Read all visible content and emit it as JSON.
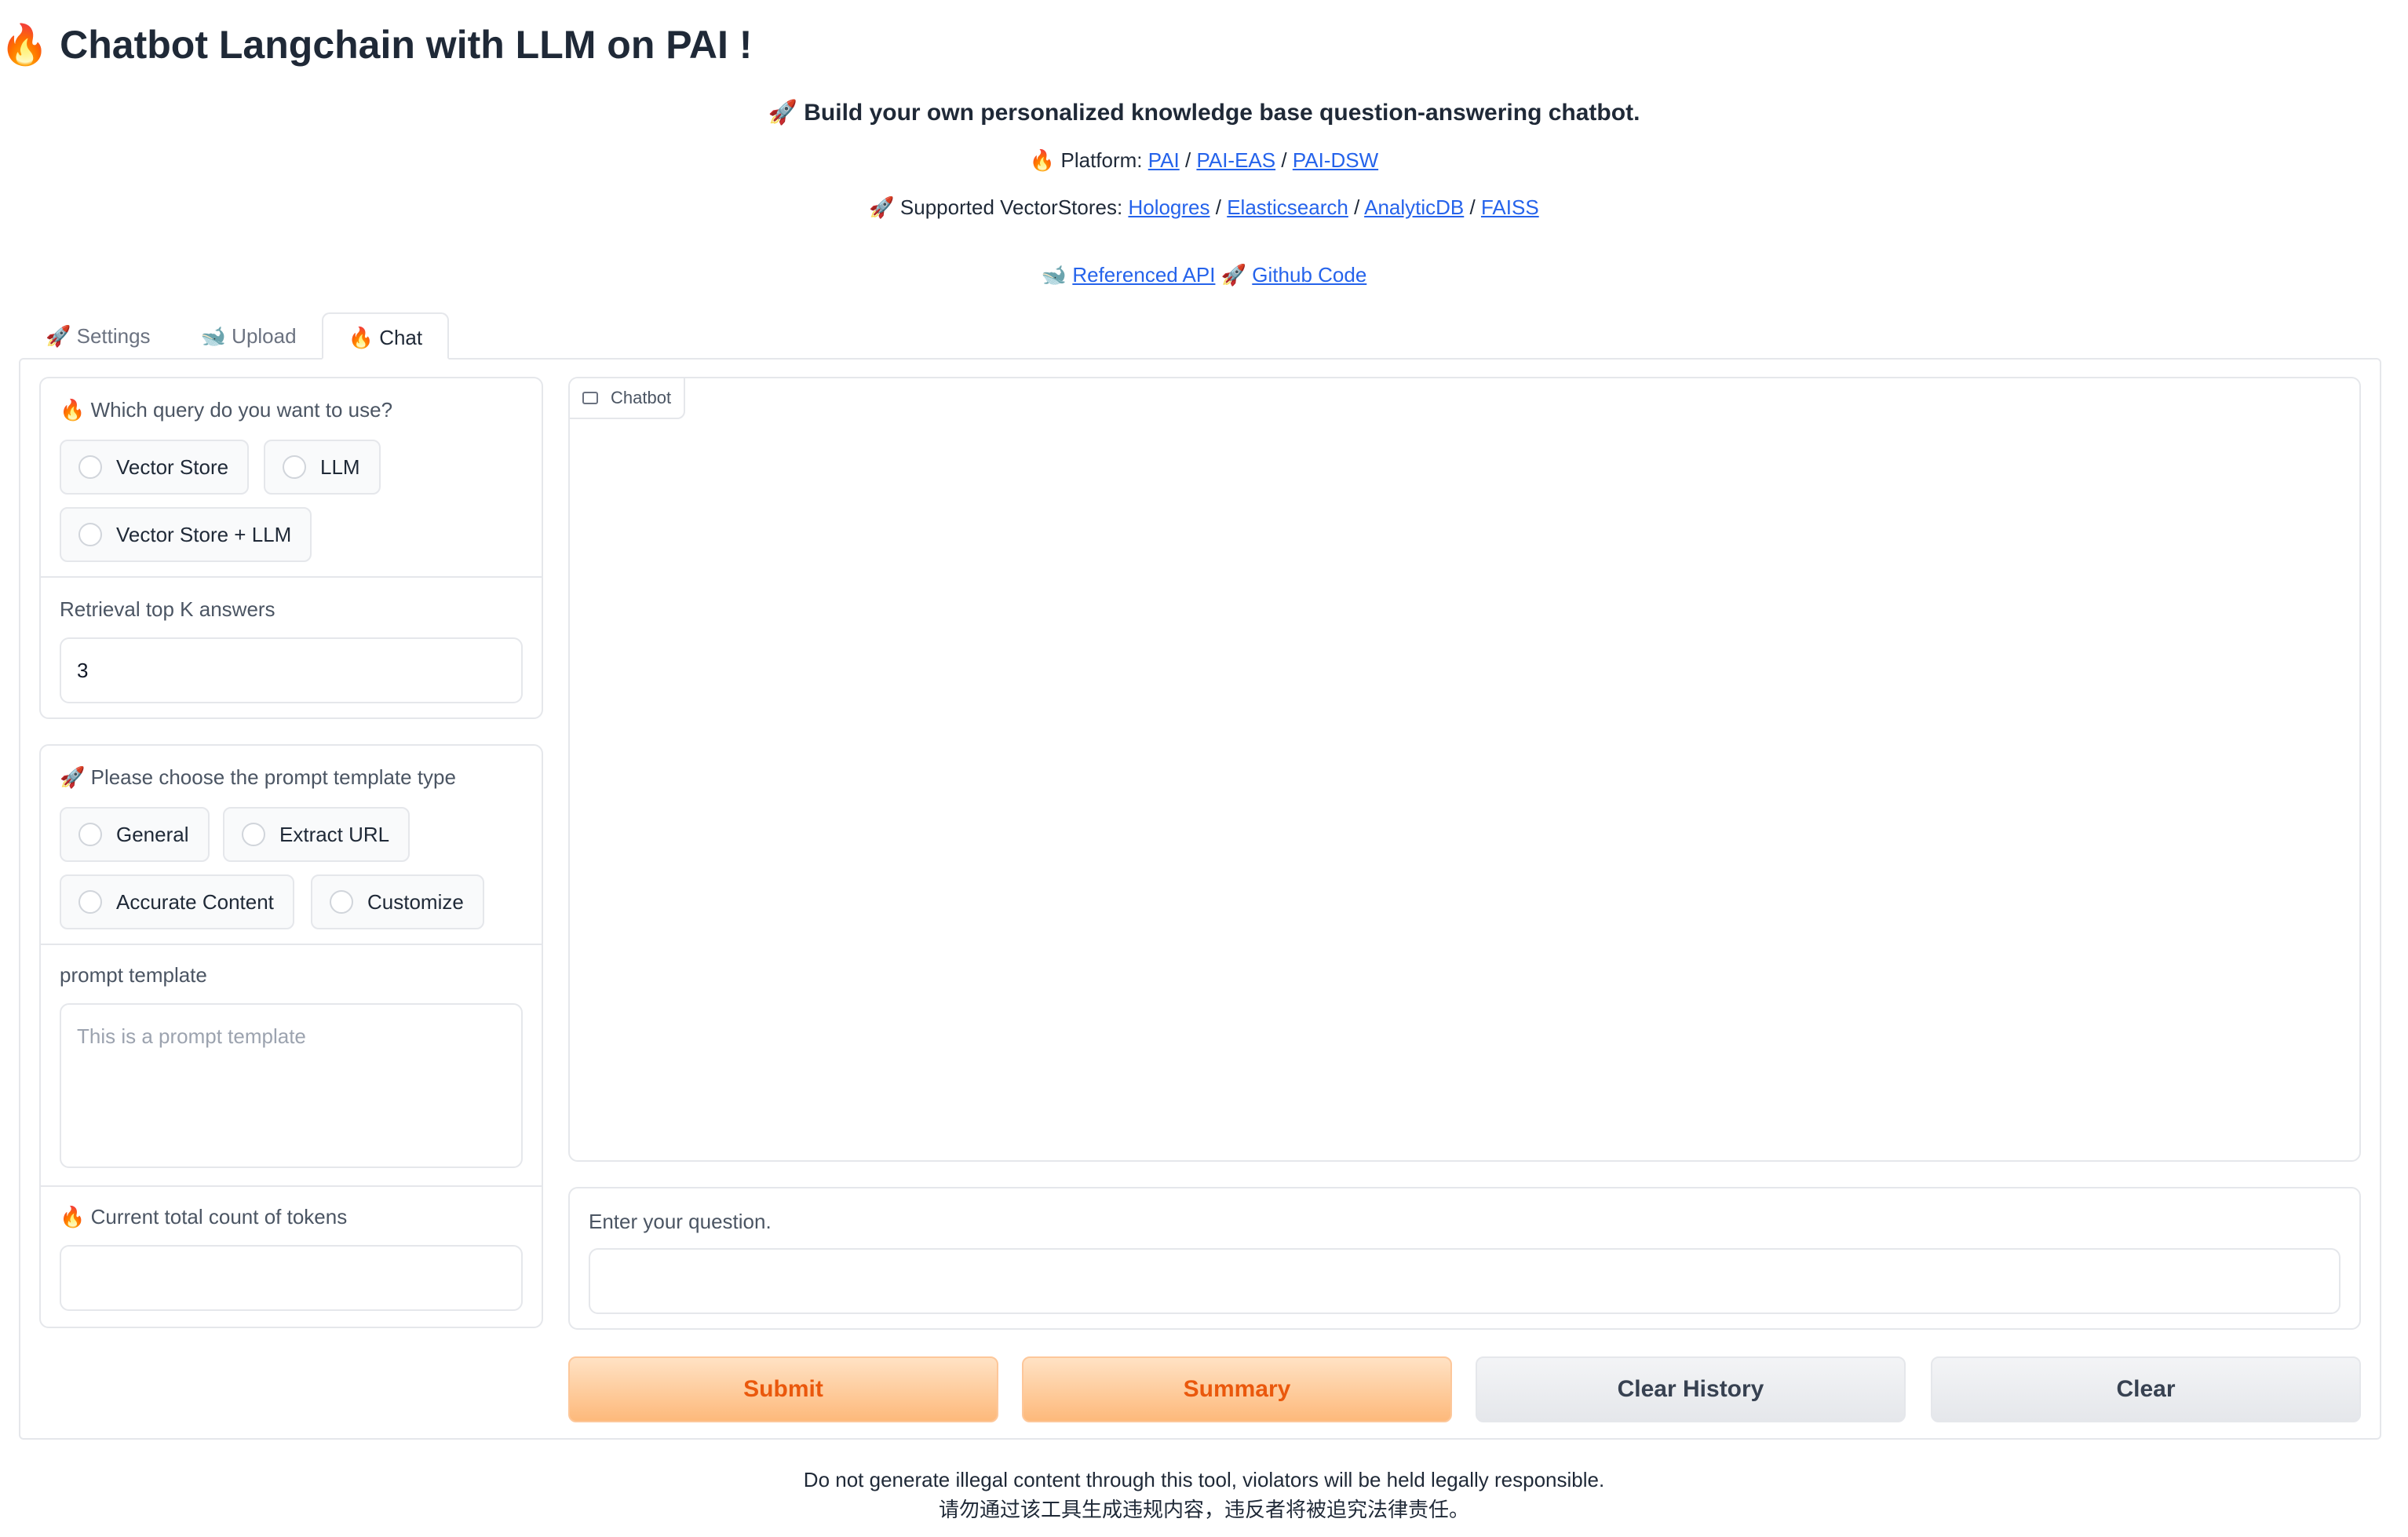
{
  "header": {
    "title": "🔥 Chatbot Langchain with LLM on PAI !",
    "subtitle": "🚀 Build your own personalized knowledge base question-answering chatbot.",
    "platform_prefix": "🔥 Platform:",
    "platform_links": [
      "PAI",
      "PAI-EAS",
      "PAI-DSW"
    ],
    "vectors_prefix": "🚀 Supported VectorStores:",
    "vector_links": [
      "Hologres",
      "Elasticsearch",
      "AnalyticDB",
      "FAISS"
    ],
    "api_emoji": "🐋",
    "api_link": "Referenced API",
    "github_emoji": "🚀",
    "github_link": "Github Code",
    "separator": "/"
  },
  "tabs": [
    {
      "emoji": "🚀",
      "label": "Settings"
    },
    {
      "emoji": "🐋",
      "label": "Upload"
    },
    {
      "emoji": "🔥",
      "label": "Chat"
    }
  ],
  "active_tab": "Chat",
  "query_section": {
    "label": "🔥 Which query do you want to use?",
    "options": [
      "Vector Store",
      "LLM",
      "Vector Store + LLM"
    ],
    "topk_label": "Retrieval top K answers",
    "topk_value": "3"
  },
  "prompt_section": {
    "label": "🚀 Please choose the prompt template type",
    "options": [
      "General",
      "Extract URL",
      "Accurate Content",
      "Customize"
    ],
    "template_label": "prompt template",
    "template_placeholder": "This is a prompt template",
    "tokens_label": "🔥 Current total count of tokens",
    "tokens_value": ""
  },
  "chatbot": {
    "label": "Chatbot"
  },
  "question": {
    "label": "Enter your question.",
    "value": ""
  },
  "buttons": {
    "submit": "Submit",
    "summary": "Summary",
    "clear_history": "Clear History",
    "clear": "Clear"
  },
  "footer": {
    "en": "Do not generate illegal content through this tool, violators will be held legally responsible.",
    "zh": "请勿通过该工具生成违规内容，违反者将被追究法律责任。"
  },
  "colors": {
    "accent": "#ea580c",
    "link": "#2563eb",
    "border": "#e5e7eb"
  }
}
